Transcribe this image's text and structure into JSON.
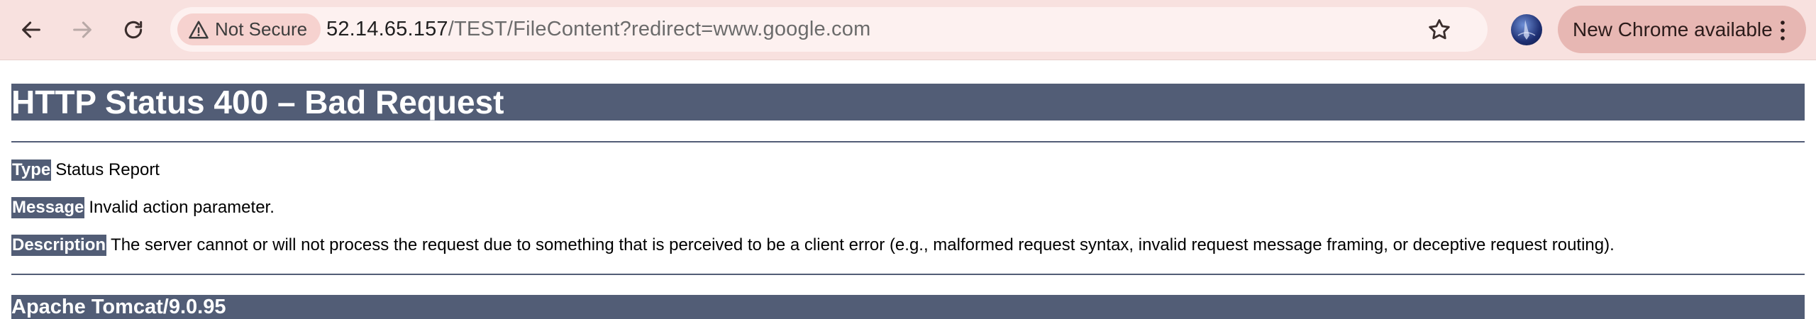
{
  "browser": {
    "security_label": "Not Secure",
    "url_host": "52.14.65.157",
    "url_path": "/TEST/FileContent?redirect=www.google.com",
    "update_label": "New Chrome available",
    "icons": {
      "back": "arrow-left-icon",
      "forward": "arrow-right-icon",
      "reload": "reload-icon",
      "warning": "warning-triangle-icon",
      "bookmark": "star-icon",
      "menu": "kebab-menu-icon"
    },
    "colors": {
      "toolbar": "#f8e1df",
      "omnibox": "#fdf1f0",
      "security_chip": "#f6d2cf",
      "update_chip": "#e7b7b3"
    }
  },
  "page": {
    "title": "HTTP Status 400 – Bad Request",
    "fields": [
      {
        "key": "Type",
        "value": "Status Report"
      },
      {
        "key": "Message",
        "value": "Invalid action parameter."
      },
      {
        "key": "Description",
        "value": "The server cannot or will not process the request due to something that is perceived to be a client error (e.g., malformed request syntax, invalid request message framing, or deceptive request routing)."
      }
    ],
    "footer": "Apache Tomcat/9.0.95",
    "colors": {
      "header_bg": "#525d76",
      "header_text": "#ffffff"
    }
  }
}
